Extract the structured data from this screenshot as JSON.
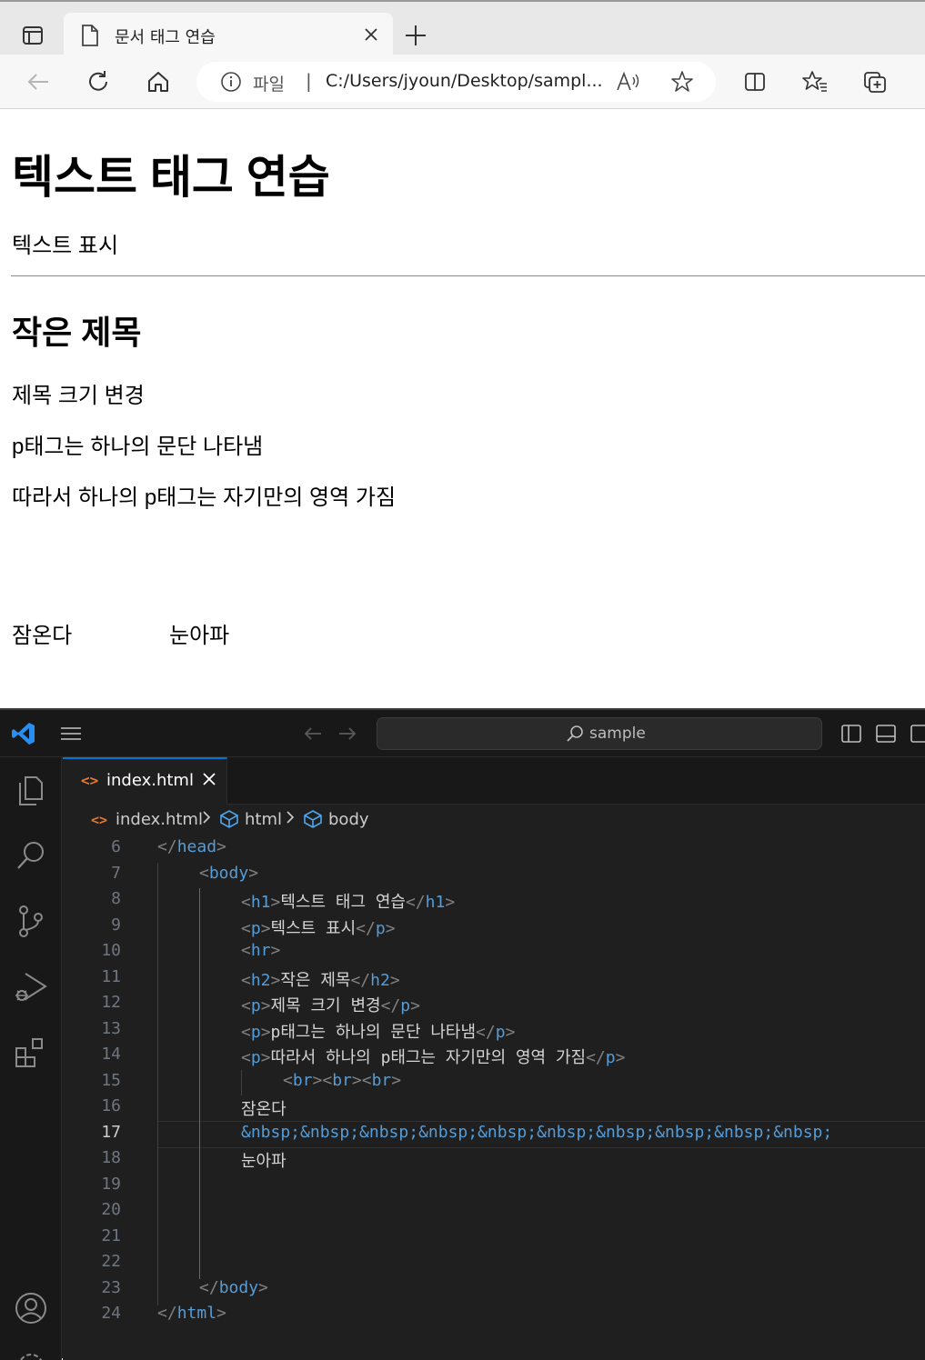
{
  "browser": {
    "tab_title": "문서 태그 연습",
    "address_scheme": "파일",
    "address_separator": "|",
    "address_url": "C:/Users/jyoun/Desktop/sampl..."
  },
  "page": {
    "h1": "텍스트 태그 연습",
    "p1": "텍스트 표시",
    "h2": "작은 제목",
    "p2": "제목 크기 변경",
    "p3": "p태그는 하나의 문단 나타냄",
    "p4": "따라서 하나의 p태그는 자기만의 영역 가짐",
    "line_left": "잠온다",
    "line_right": "눈아파"
  },
  "vscode": {
    "search_placeholder": "sample",
    "tab_name": "index.html",
    "breadcrumb": [
      "index.html",
      "html",
      "body"
    ],
    "active_line": 17,
    "lines": [
      {
        "n": "6",
        "tokens": [
          [
            "br",
            "</"
          ],
          [
            "tg",
            "head"
          ],
          [
            "br",
            ">"
          ]
        ]
      },
      {
        "n": "7",
        "tokens": [
          [
            "br",
            "<"
          ],
          [
            "tg",
            "body"
          ],
          [
            "br",
            ">"
          ]
        ]
      },
      {
        "n": "8",
        "tokens": [
          [
            "br",
            "<"
          ],
          [
            "tg",
            "h1"
          ],
          [
            "br",
            ">"
          ],
          [
            "tx",
            "텍스트 태그 연습"
          ],
          [
            "br",
            "</"
          ],
          [
            "tg",
            "h1"
          ],
          [
            "br",
            ">"
          ]
        ]
      },
      {
        "n": "9",
        "tokens": [
          [
            "br",
            "<"
          ],
          [
            "tg",
            "p"
          ],
          [
            "br",
            ">"
          ],
          [
            "tx",
            "텍스트 표시"
          ],
          [
            "br",
            "</"
          ],
          [
            "tg",
            "p"
          ],
          [
            "br",
            ">"
          ]
        ]
      },
      {
        "n": "10",
        "tokens": [
          [
            "br",
            "<"
          ],
          [
            "tg",
            "hr"
          ],
          [
            "br",
            ">"
          ]
        ]
      },
      {
        "n": "11",
        "tokens": [
          [
            "br",
            "<"
          ],
          [
            "tg",
            "h2"
          ],
          [
            "br",
            ">"
          ],
          [
            "tx",
            "작은 제목"
          ],
          [
            "br",
            "</"
          ],
          [
            "tg",
            "h2"
          ],
          [
            "br",
            ">"
          ]
        ]
      },
      {
        "n": "12",
        "tokens": [
          [
            "br",
            "<"
          ],
          [
            "tg",
            "p"
          ],
          [
            "br",
            ">"
          ],
          [
            "tx",
            "제목 크기 변경"
          ],
          [
            "br",
            "</"
          ],
          [
            "tg",
            "p"
          ],
          [
            "br",
            ">"
          ]
        ]
      },
      {
        "n": "13",
        "tokens": [
          [
            "br",
            "<"
          ],
          [
            "tg",
            "p"
          ],
          [
            "br",
            ">"
          ],
          [
            "tx",
            "p태그는 하나의 문단 나타냄"
          ],
          [
            "br",
            "</"
          ],
          [
            "tg",
            "p"
          ],
          [
            "br",
            ">"
          ]
        ]
      },
      {
        "n": "14",
        "tokens": [
          [
            "br",
            "<"
          ],
          [
            "tg",
            "p"
          ],
          [
            "br",
            ">"
          ],
          [
            "tx",
            "따라서 하나의 p태그는 자기만의 영역 가짐"
          ],
          [
            "br",
            "</"
          ],
          [
            "tg",
            "p"
          ],
          [
            "br",
            ">"
          ]
        ]
      },
      {
        "n": "15",
        "tokens": [
          [
            "br",
            "<"
          ],
          [
            "tg",
            "br"
          ],
          [
            "br",
            "><"
          ],
          [
            "tg",
            "br"
          ],
          [
            "br",
            "><"
          ],
          [
            "tg",
            "br"
          ],
          [
            "br",
            ">"
          ]
        ]
      },
      {
        "n": "16",
        "tokens": [
          [
            "tx",
            "잠온다"
          ]
        ]
      },
      {
        "n": "17",
        "tokens": [
          [
            "ent",
            "&nbsp;&nbsp;&nbsp;&nbsp;&nbsp;&nbsp;&nbsp;&nbsp;&nbsp;&nbsp;"
          ]
        ]
      },
      {
        "n": "18",
        "tokens": [
          [
            "tx",
            "눈아파"
          ]
        ]
      },
      {
        "n": "19",
        "tokens": []
      },
      {
        "n": "20",
        "tokens": []
      },
      {
        "n": "21",
        "tokens": []
      },
      {
        "n": "22",
        "tokens": []
      },
      {
        "n": "23",
        "tokens": [
          [
            "br",
            "</"
          ],
          [
            "tg",
            "body"
          ],
          [
            "br",
            ">"
          ]
        ]
      },
      {
        "n": "24",
        "tokens": [
          [
            "br",
            "</"
          ],
          [
            "tg",
            "html"
          ],
          [
            "br",
            ">"
          ]
        ]
      }
    ]
  }
}
